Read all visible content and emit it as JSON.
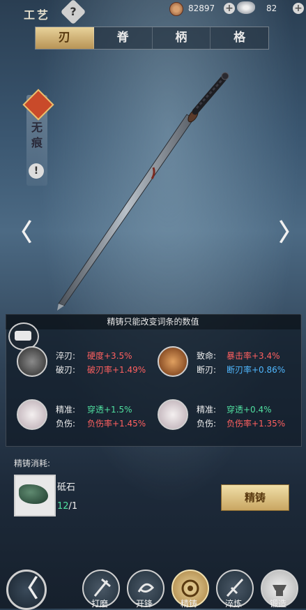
{
  "header": {
    "title": "工艺",
    "help_glyph": "?",
    "copper": "82897",
    "silver": "82",
    "plus": "+"
  },
  "tabs": [
    {
      "label": "刃",
      "active": true
    },
    {
      "label": "脊",
      "active": false
    },
    {
      "label": "柄",
      "active": false
    },
    {
      "label": "格",
      "active": false
    }
  ],
  "weapon": {
    "name_line1": "无",
    "name_line2": "痕",
    "alert": "!"
  },
  "nav_arrows": {
    "left": "〈",
    "right": "〉"
  },
  "panel": {
    "hint": "精铸只能改变词条的数值",
    "stats": [
      {
        "label1": "淬刃:",
        "value1": "硬度+3.5%",
        "label2": "破刃:",
        "value2": "破刃率+1.49%"
      },
      {
        "label1": "致命:",
        "value1": "暴击率+3.4%",
        "label2": "断刃:",
        "value2": "断刃率+0.86%"
      },
      {
        "label1": "精准:",
        "value1": "穿透+1.5%",
        "label2": "负伤:",
        "value2": "负伤率+1.45%"
      },
      {
        "label1": "精准:",
        "value1": "穿透+0.4%",
        "label2": "负伤:",
        "value2": "负伤率+1.35%"
      }
    ]
  },
  "cost": {
    "title": "精铸消耗:",
    "item_name": "砥石",
    "have": "12",
    "need": "/1"
  },
  "refine_button": "精铸",
  "bottom_nav": {
    "back": "〈",
    "items": [
      {
        "label": "打磨",
        "icon": "hammer-icon",
        "active": false
      },
      {
        "label": "开锋",
        "icon": "swirl-icon",
        "active": false
      },
      {
        "label": "精铸",
        "icon": "forge-icon",
        "active": true
      },
      {
        "label": "淬炼",
        "icon": "sword-icon",
        "active": false
      },
      {
        "label": "锻造",
        "icon": "anvil-icon",
        "active": false
      }
    ]
  },
  "colors": {
    "accent_gold": "#c9a662",
    "stat_red": "#ff6060",
    "stat_green": "#50e0a0",
    "stat_blue": "#50b8ff"
  }
}
